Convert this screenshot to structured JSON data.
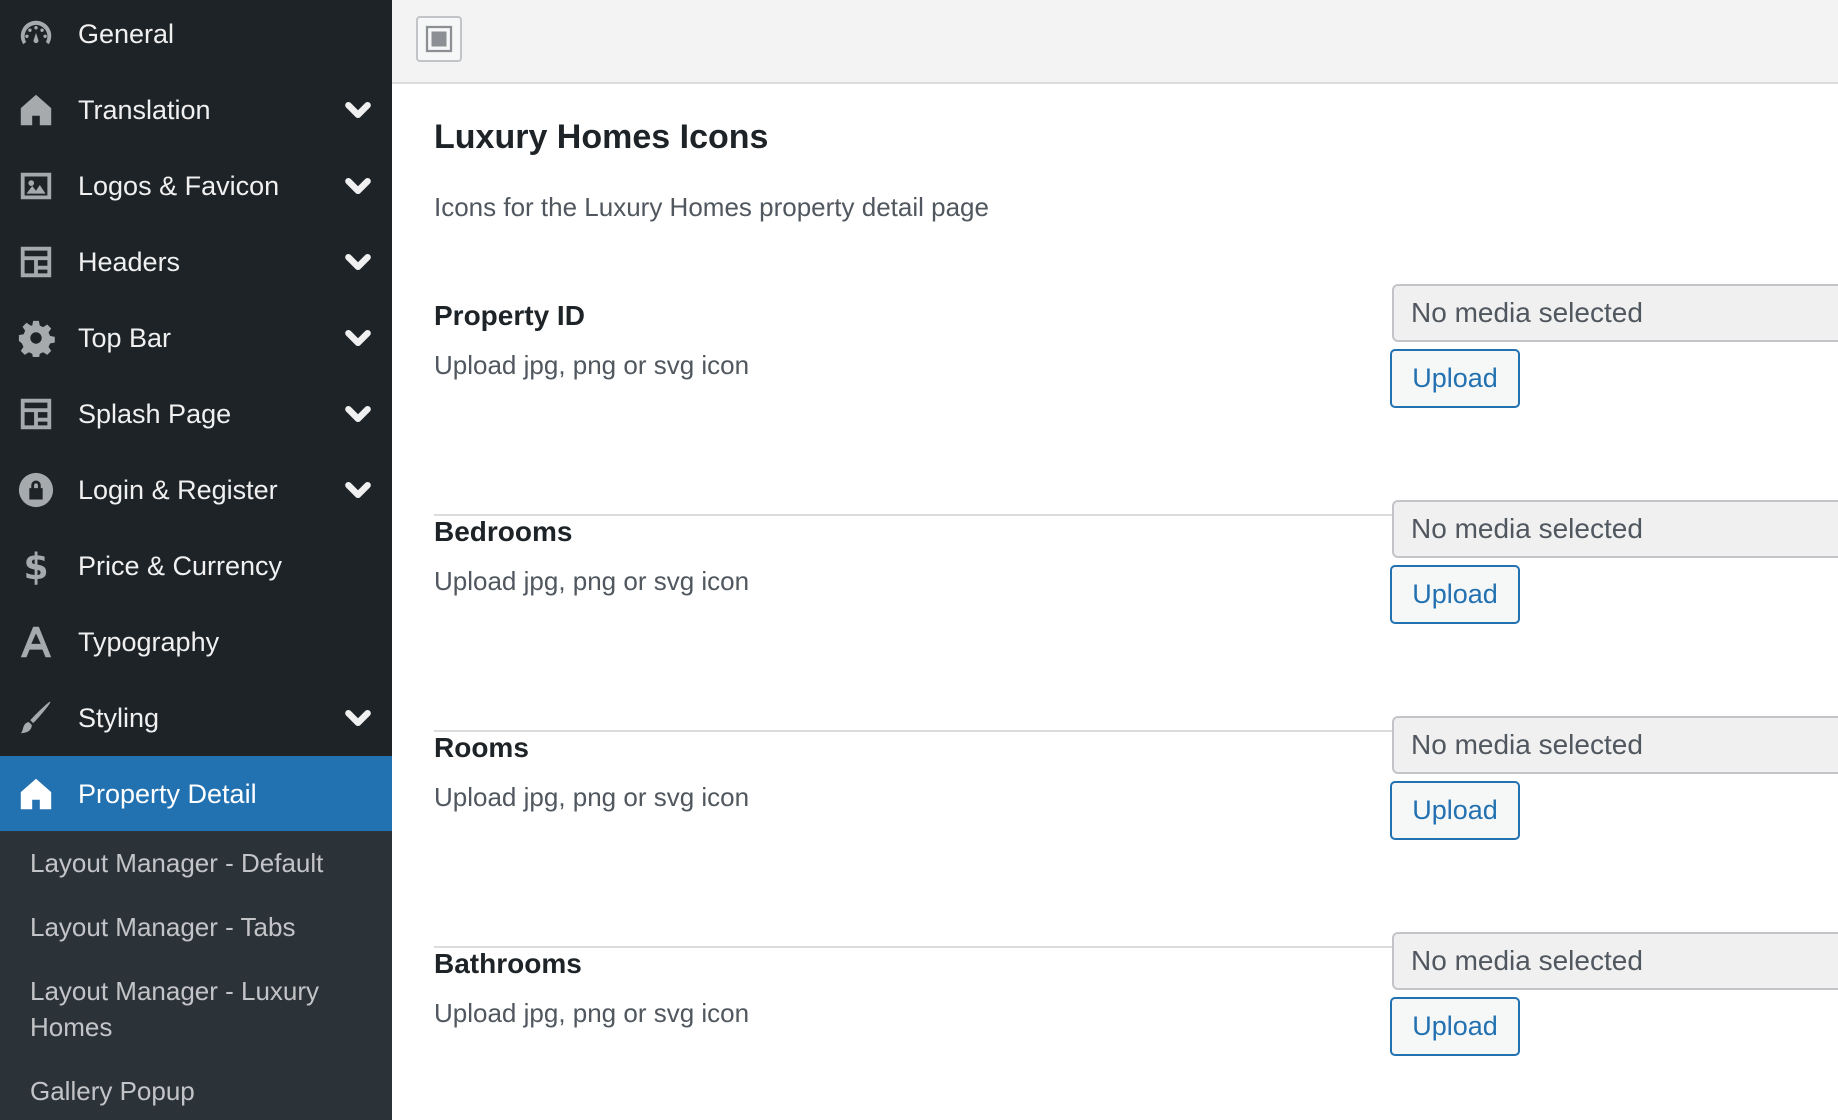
{
  "sidebar": {
    "items": [
      {
        "label": "General",
        "icon": "dashboard-icon",
        "has_submenu": false
      },
      {
        "label": "Translation",
        "icon": "home-icon",
        "has_submenu": true
      },
      {
        "label": "Logos & Favicon",
        "icon": "image-icon",
        "has_submenu": true
      },
      {
        "label": "Headers",
        "icon": "layout-icon",
        "has_submenu": true
      },
      {
        "label": "Top Bar",
        "icon": "gear-icon",
        "has_submenu": true
      },
      {
        "label": "Splash Page",
        "icon": "layout-icon",
        "has_submenu": true
      },
      {
        "label": "Login & Register",
        "icon": "lock-icon",
        "has_submenu": true
      },
      {
        "label": "Price & Currency",
        "icon": "dollar-icon",
        "has_submenu": false
      },
      {
        "label": "Typography",
        "icon": "font-icon",
        "has_submenu": false
      },
      {
        "label": "Styling",
        "icon": "brush-icon",
        "has_submenu": true
      },
      {
        "label": "Property Detail",
        "icon": "home-icon",
        "has_submenu": false,
        "active": true
      }
    ],
    "submenu": [
      {
        "label": "Layout Manager - Default"
      },
      {
        "label": "Layout Manager - Tabs"
      },
      {
        "label": "Layout Manager - Luxury Homes"
      },
      {
        "label": "Gallery Popup"
      }
    ]
  },
  "main": {
    "title": "Luxury Homes Icons",
    "description": "Icons for the Luxury Homes property detail page",
    "fields": [
      {
        "title": "Property ID",
        "help": "Upload jpg, png or svg icon",
        "media_placeholder": "No media selected",
        "button_label": "Upload"
      },
      {
        "title": "Bedrooms",
        "help": "Upload jpg, png or svg icon",
        "media_placeholder": "No media selected",
        "button_label": "Upload"
      },
      {
        "title": "Rooms",
        "help": "Upload jpg, png or svg icon",
        "media_placeholder": "No media selected",
        "button_label": "Upload"
      },
      {
        "title": "Bathrooms",
        "help": "Upload jpg, png or svg icon",
        "media_placeholder": "No media selected",
        "button_label": "Upload"
      }
    ]
  },
  "colors": {
    "sidebar_bg": "#1d2327",
    "submenu_bg": "#2c3338",
    "accent": "#2271b1"
  }
}
